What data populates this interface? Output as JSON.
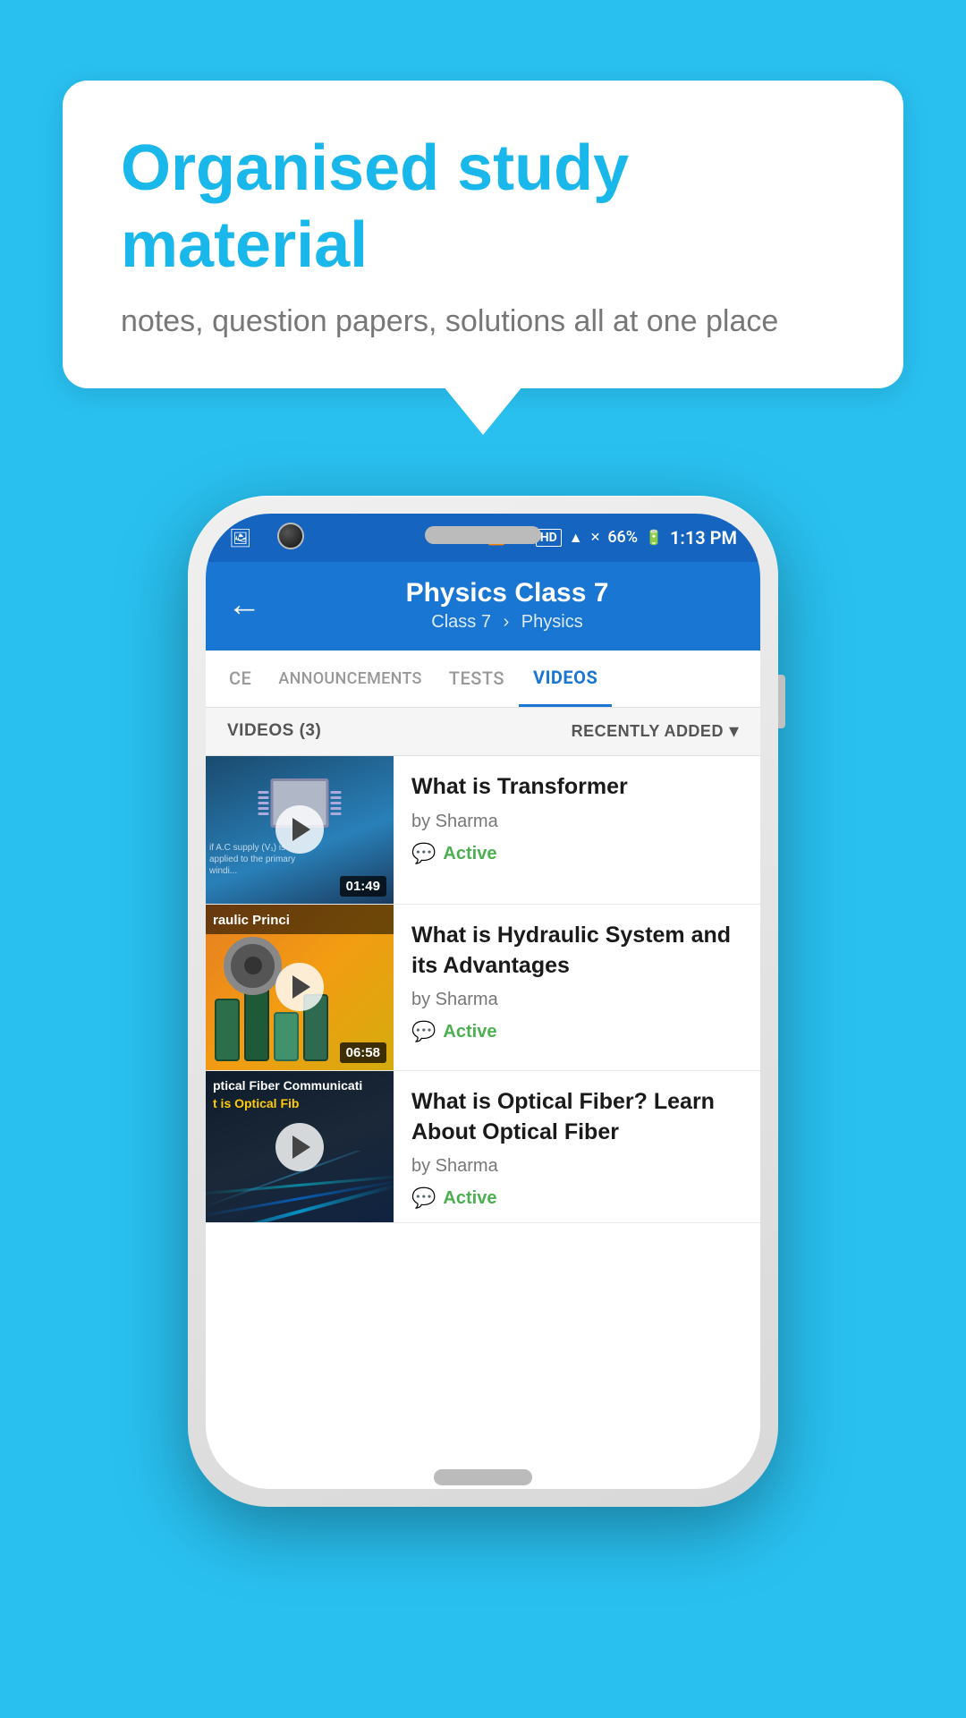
{
  "page": {
    "background_color": "#1ab7ea"
  },
  "speech_bubble": {
    "title": "Organised study material",
    "subtitle": "notes, question papers, solutions all at one place"
  },
  "status_bar": {
    "battery": "66%",
    "time": "1:13 PM",
    "signal_icons": "bluetooth vibrate hd wifi signal"
  },
  "app_bar": {
    "back_label": "←",
    "title": "Physics Class 7",
    "subtitle_class": "Class 7",
    "subtitle_subject": "Physics"
  },
  "tabs": [
    {
      "id": "ce",
      "label": "CE",
      "active": false
    },
    {
      "id": "announcements",
      "label": "ANNOUNCEMENTS",
      "active": false
    },
    {
      "id": "tests",
      "label": "TESTS",
      "active": false
    },
    {
      "id": "videos",
      "label": "VIDEOS",
      "active": true
    }
  ],
  "videos_header": {
    "count_label": "VIDEOS (3)",
    "sort_label": "RECENTLY ADDED",
    "sort_icon": "▾"
  },
  "videos": [
    {
      "id": 1,
      "title": "What is  Transformer",
      "author": "by Sharma",
      "status": "Active",
      "duration": "01:49",
      "thumb_type": "transformer",
      "thumb_badge": "AC"
    },
    {
      "id": 2,
      "title": "What is Hydraulic System and its Advantages",
      "author": "by Sharma",
      "status": "Active",
      "duration": "06:58",
      "thumb_type": "hydraulic",
      "thumb_header": "raulic Princi"
    },
    {
      "id": 3,
      "title": "What is Optical Fiber? Learn About Optical Fiber",
      "author": "by Sharma",
      "status": "Active",
      "duration": "",
      "thumb_type": "optical",
      "thumb_line1": "ptical Fiber Communicati",
      "thumb_line2": "t is Optical Fib"
    }
  ]
}
